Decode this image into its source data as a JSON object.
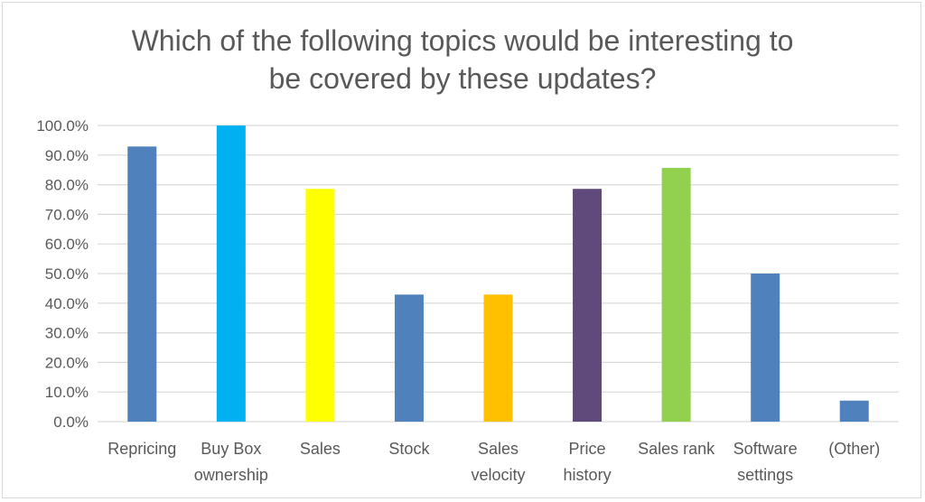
{
  "chart_data": {
    "type": "bar",
    "title_lines": [
      "Which of the following topics would be interesting to",
      "be covered by these updates?"
    ],
    "categories": [
      [
        "Repricing"
      ],
      [
        "Buy Box",
        "ownership"
      ],
      [
        "Sales"
      ],
      [
        "Stock"
      ],
      [
        "Sales",
        "velocity"
      ],
      [
        "Price",
        "history"
      ],
      [
        "Sales rank"
      ],
      [
        "Software",
        "settings"
      ],
      [
        "(Other)"
      ]
    ],
    "values": [
      92.9,
      100.0,
      78.6,
      42.9,
      42.9,
      78.6,
      85.7,
      50.0,
      7.1
    ],
    "colors": [
      "#4f81bd",
      "#00b0f0",
      "#ffff00",
      "#4f81bd",
      "#ffc000",
      "#604a7b",
      "#92d050",
      "#4f81bd",
      "#4f81bd"
    ],
    "ylim": [
      0,
      100
    ],
    "yticks": [
      0,
      10,
      20,
      30,
      40,
      50,
      60,
      70,
      80,
      90,
      100
    ],
    "ytick_labels": [
      "0.0%",
      "10.0%",
      "20.0%",
      "30.0%",
      "40.0%",
      "50.0%",
      "60.0%",
      "70.0%",
      "80.0%",
      "90.0%",
      "100.0%"
    ],
    "xlabel": "",
    "ylabel": "",
    "grid": true,
    "legend": "none"
  }
}
